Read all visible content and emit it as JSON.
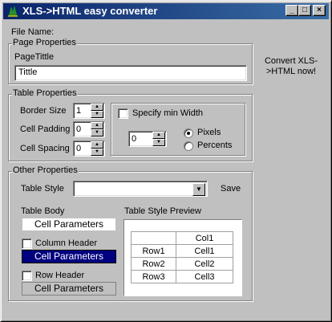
{
  "window": {
    "title": "XLS->HTML easy converter",
    "controls": {
      "minimize": "_",
      "maximize": "□",
      "close": "×"
    }
  },
  "file_name_label": "File Name:",
  "convert_button_label": "Convert XLS->HTML now!",
  "page_properties": {
    "group_title": "Page Properties",
    "title_label": "PageTittle",
    "title_value": "Tittle"
  },
  "table_properties": {
    "group_title": "Table Properties",
    "border_size_label": "Border Size",
    "border_size_value": "1",
    "cell_padding_label": "Cell Padding",
    "cell_padding_value": "0",
    "cell_spacing_label": "Cell Spacing",
    "cell_spacing_value": "0",
    "min_width_label": "Specify min Width",
    "min_width_checked": false,
    "min_width_value": "0",
    "unit_pixels_label": "Pixels",
    "unit_percents_label": "Percents",
    "unit_selected": "Pixels"
  },
  "other_properties": {
    "group_title": "Other Properties",
    "table_style_label": "Table Style",
    "table_style_value": "",
    "save_label": "Save",
    "table_body_label": "Table Body",
    "table_body_button": "Cell Parameters",
    "column_header_label": "Column Header",
    "column_header_checked": false,
    "column_header_button": "Cell Parameters",
    "row_header_label": "Row Header",
    "row_header_checked": false,
    "row_header_button": "Cell Parameters",
    "preview_label": "Table Style Preview",
    "preview_table": {
      "header": [
        "",
        "Col1"
      ],
      "rows": [
        [
          "Row1",
          "Cell1"
        ],
        [
          "Row2",
          "Cell2"
        ],
        [
          "Row3",
          "Cell3"
        ]
      ]
    }
  },
  "colors": {
    "titlebar_start": "#0a246a",
    "titlebar_end": "#3a6ea5",
    "face": "#c0c0c0",
    "selected_fill": "#000080"
  }
}
